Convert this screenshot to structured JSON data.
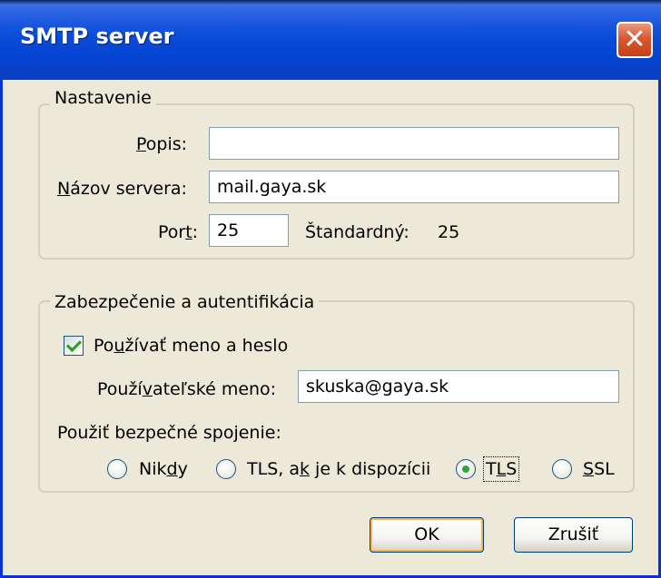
{
  "window": {
    "title": "SMTP server",
    "close_glyph": "✕"
  },
  "settings": {
    "legend": "Nastavenie",
    "description_label": {
      "pre": "",
      "key": "P",
      "post": "opis:"
    },
    "description_value": "",
    "server_label": {
      "pre": "",
      "key": "N",
      "post": "ázov servera:"
    },
    "server_value": "mail.gaya.sk",
    "port_label": {
      "pre": "Por",
      "key": "t",
      "post": ":"
    },
    "port_value": "25",
    "default_label": "Štandardný:",
    "default_value": "25"
  },
  "security": {
    "legend": "Zabezpečenie a autentifikácia",
    "use_auth": {
      "checked": true,
      "pre": "Po",
      "key": "u",
      "post": "žívať meno a heslo"
    },
    "username_label": {
      "pre": "Použí",
      "key": "v",
      "post": "ateľské meno:"
    },
    "username_value": "skuska@gaya.sk",
    "connection_label": "Použiť bezpečné spojenie:",
    "options": [
      {
        "pre": "Nik",
        "key": "d",
        "post": "y",
        "selected": false
      },
      {
        "pre": "TLS, a",
        "key": "k",
        "post": " je k dispozícii",
        "selected": false
      },
      {
        "pre": "T",
        "key": "L",
        "post": "S",
        "selected": true
      },
      {
        "pre": "",
        "key": "S",
        "post": "SL",
        "selected": false
      }
    ]
  },
  "buttons": {
    "ok": "OK",
    "cancel": "Zrušiť"
  },
  "colors": {
    "titlebar": "#0b4cd9",
    "dialog_bg": "#ece9d8",
    "close": "#d9582f",
    "check": "#21a121",
    "radio_dot": "#2fa83a",
    "default_button_ring": "#f6b54a"
  }
}
